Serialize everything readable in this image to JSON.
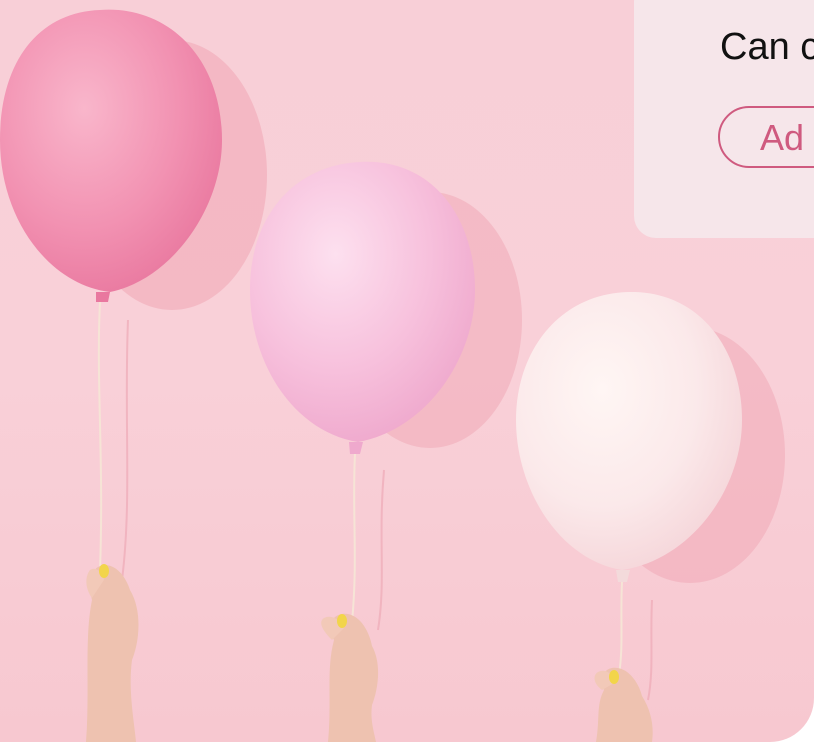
{
  "card": {
    "text": "Can c",
    "button_label": "Ad"
  },
  "colors": {
    "background": "#f9d0d8",
    "card_background": "#f6e6ea",
    "accent": "#cf5a7f",
    "balloon_hot_pink": "#f28fb0",
    "balloon_light_pink": "#f7bfdc",
    "balloon_white": "#fbe9ea",
    "nail_yellow": "#f2d54a"
  },
  "image": {
    "alt": "balloons-photo"
  }
}
